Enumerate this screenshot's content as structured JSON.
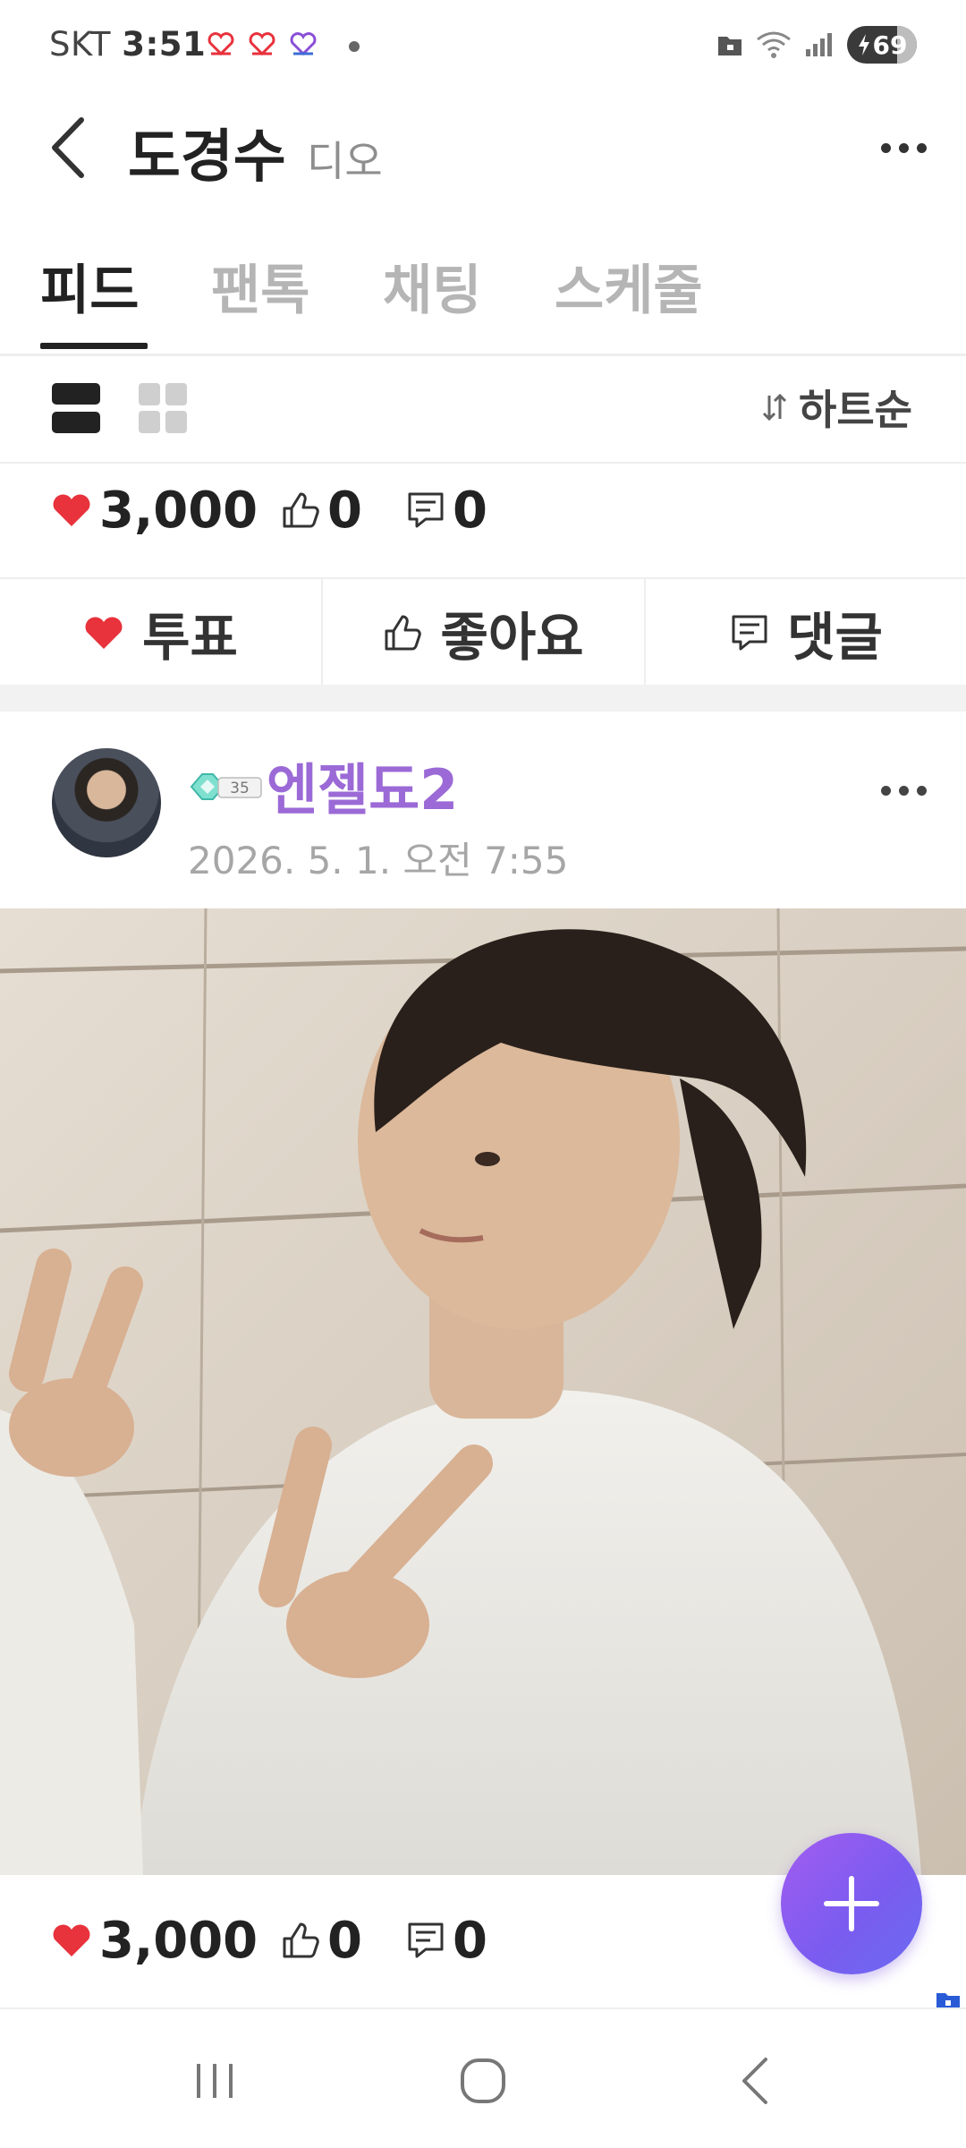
{
  "status_bar": {
    "carrier": "SKT",
    "time": "3:51",
    "battery": "69"
  },
  "header": {
    "title": "도경수",
    "subtitle": "디오"
  },
  "tabs": [
    {
      "label": "피드",
      "active": true
    },
    {
      "label": "팬톡",
      "active": false
    },
    {
      "label": "채팅",
      "active": false
    },
    {
      "label": "스케줄",
      "active": false
    }
  ],
  "toolbar": {
    "sort_label": "하트순"
  },
  "previous_post": {
    "hearts": "3,000",
    "likes": "0",
    "comments": "0"
  },
  "actions": {
    "vote": "투표",
    "like": "좋아요",
    "comment": "댓글"
  },
  "post": {
    "username": "엔젤됴2",
    "level": "35",
    "date": "2026. 5. 1. 오전 7:55",
    "hearts": "3,000",
    "likes": "0",
    "comments": "0"
  },
  "colors": {
    "heart": "#e8323c",
    "username": "#9b6ad6",
    "fab_start": "#a35cf0",
    "fab_end": "#6a6af0"
  },
  "icons": [
    "back-icon",
    "more-icon",
    "list-view-icon",
    "grid-view-icon",
    "sort-icon",
    "heart-icon",
    "thumbs-up-icon",
    "comment-icon",
    "plus-icon"
  ]
}
